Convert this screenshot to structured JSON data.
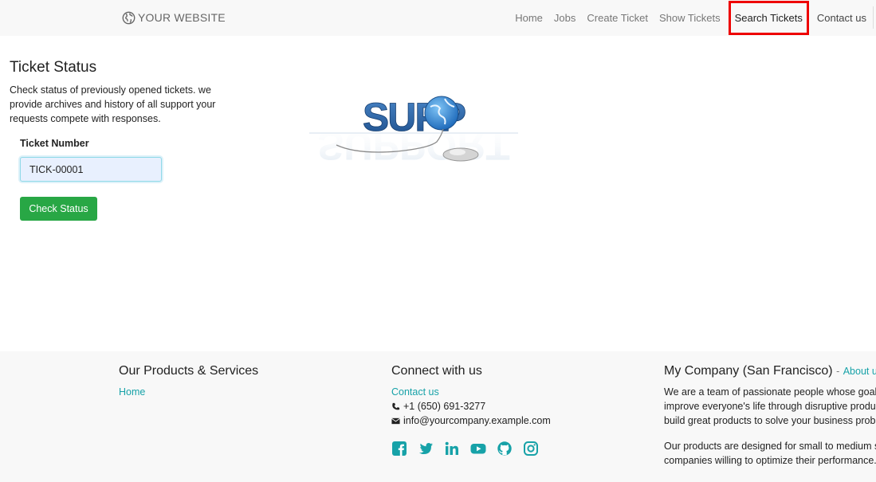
{
  "navbar": {
    "brand": "YOUR WEBSITE",
    "links": [
      "Home",
      "Jobs",
      "Create Ticket",
      "Show Tickets",
      "Search Tickets",
      "Contact us"
    ]
  },
  "main": {
    "title": "Ticket Status",
    "description": "Check status of previously opened tickets. we provide archives and history of all support your requests compete with responses.",
    "field_label": "Ticket Number",
    "ticket_value": "TICK-00001",
    "button_label": "Check Status",
    "image_word": "SUPPORT"
  },
  "footer": {
    "products_title": "Our Products & Services",
    "products_link": "Home",
    "connect_title": "Connect with us",
    "contact_link": "Contact us",
    "phone": "+1 (650) 691-3277",
    "email": "info@yourcompany.example.com",
    "social_icons": [
      "facebook-icon",
      "twitter-icon",
      "linkedin-icon",
      "youtube-icon",
      "github-icon",
      "instagram-icon"
    ],
    "company_title": "My Company (San Francisco)",
    "separator": "-",
    "about_link": "About us",
    "about_line1": "We are a team of passionate people whose goal is to",
    "about_line2": "improve everyone's life through disruptive products. We",
    "about_line3": "build great products to solve your business problems.",
    "about_line4": "Our products are designed for small to medium size",
    "about_line5": "companies willing to optimize their performance."
  },
  "colors": {
    "accent": "#17a2a8",
    "button": "#28a745",
    "highlight": "#ee0000"
  }
}
